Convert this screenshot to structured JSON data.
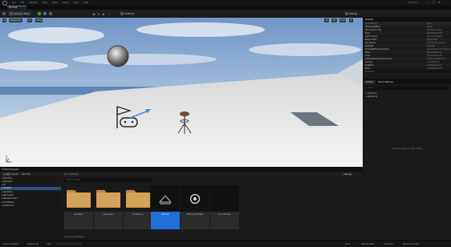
{
  "menu": {
    "items": [
      "File",
      "Edit",
      "Window",
      "Tools",
      "Build",
      "Select",
      "Actor",
      "Help"
    ],
    "project": "MyProject",
    "window_buttons": [
      "—",
      "▢",
      "✕"
    ]
  },
  "tabs": {
    "level_tab": "Minimal"
  },
  "toolbar": {
    "save_label": "Selection Mode",
    "platforms_label": "Platforms",
    "play_icons": [
      "▶",
      "⏸",
      "⏹"
    ],
    "settings_label": "Settings"
  },
  "viewport": {
    "buttons": [
      "☰",
      "Perspective",
      "Lit",
      "Show"
    ],
    "right_buttons": [
      "10",
      "10°",
      "0.25",
      "4"
    ],
    "camera_speed": "4"
  },
  "outliner": {
    "title": "Outliner",
    "columns": [
      "Item Label ▲",
      "Type"
    ],
    "rows": [
      {
        "label": "Minimal (Editor)",
        "type": "World"
      },
      {
        "label": "Atmospheric Fog",
        "type": "AtmosphericFog"
      },
      {
        "label": "Floor",
        "type": "StaticMeshActor"
      },
      {
        "label": "Light Source",
        "type": "DirectionalLight"
      },
      {
        "label": "Player Start",
        "type": "PlayerStart"
      },
      {
        "label": "Sky Sphere",
        "type": "Edit BP_Sky_Sphere"
      },
      {
        "label": "SkyLight",
        "type": "SkyLight"
      },
      {
        "label": "SphereReflectionCapture",
        "type": "SphereReflectionCapture"
      },
      {
        "label": "Table",
        "type": "StaticMeshActor"
      },
      {
        "label": "Chair",
        "type": "StaticMeshActor"
      },
      {
        "label": "Global Post Process Volume",
        "type": "PostProcessVolume"
      },
      {
        "label": "Camera",
        "type": "CameraActor"
      },
      {
        "label": "Ambient",
        "type": "AmbientSound"
      },
      {
        "label": "Stool",
        "type": "StaticMeshActor"
      }
    ],
    "count": "14 actors"
  },
  "details": {
    "tabs": [
      "Details",
      "World Settings"
    ],
    "search_placeholder": "Search",
    "rows": [
      {
        "label": "▸ Transform",
        "value": ""
      },
      {
        "label": "▸ Rendering",
        "value": ""
      }
    ],
    "empty_text": "Select an object to view details."
  },
  "content_browser": {
    "title": "Content Browser",
    "add_label": "+ Add",
    "import_label": "Import",
    "save_all_label": "Save All",
    "path": "All > Content",
    "settings_label": "Settings",
    "search_placeholder": "Search Content",
    "tree": [
      {
        "label": "▸ Favorites",
        "selected": false
      },
      {
        "label": "▾ MyProject",
        "selected": false
      },
      {
        "label": "  ▾ All",
        "selected": false
      },
      {
        "label": "    ▾ Content",
        "selected": true
      },
      {
        "label": "      ▸ Geometry",
        "selected": false
      },
      {
        "label": "      ▸ Mannequin",
        "selected": false
      },
      {
        "label": "      ▸ StarterContent",
        "selected": false
      },
      {
        "label": "      ▸ ThirdPerson",
        "selected": false
      },
      {
        "label": "▸ Collections",
        "selected": false
      }
    ],
    "assets": [
      {
        "name": "Geometry",
        "kind": "folder",
        "selected": false
      },
      {
        "name": "Mannequin",
        "kind": "folder",
        "selected": false
      },
      {
        "name": "ThirdPerson",
        "kind": "folder",
        "selected": false
      },
      {
        "name": "Minimal",
        "kind": "level",
        "selected": true
      },
      {
        "name": "Minimal_BuiltData",
        "kind": "data",
        "selected": false
      },
      {
        "name": "M_Landscape",
        "kind": "material",
        "selected": false
      }
    ],
    "count_text": "6 items (1 selected)"
  },
  "statusbar": {
    "items": [
      "Content Drawer",
      "Output Log",
      "Cmd",
      "Enter Console Command"
    ],
    "right_items": [
      "Trace",
      "Derived Data",
      "All Saved",
      "Revision Control"
    ]
  }
}
